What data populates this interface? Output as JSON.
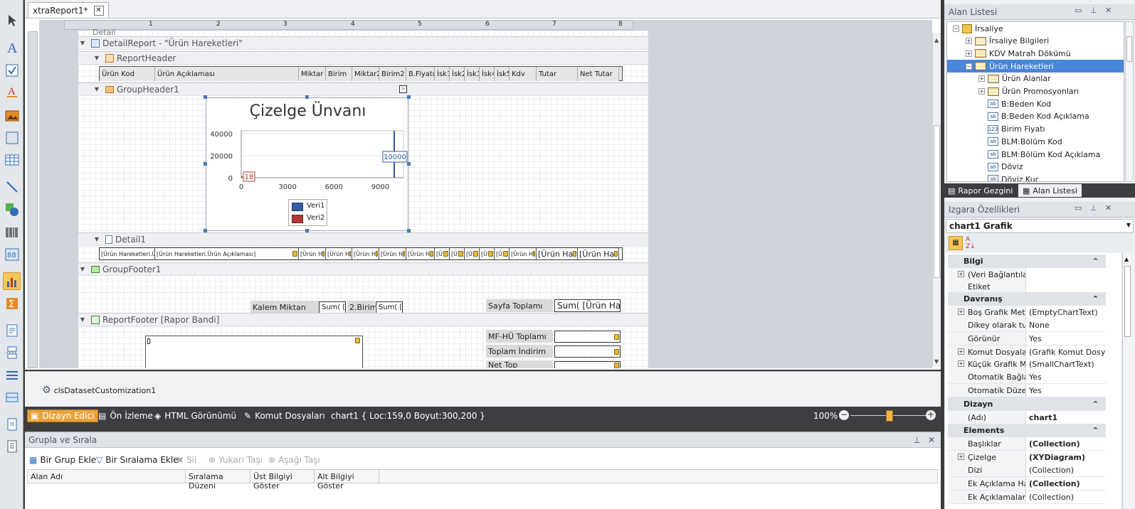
{
  "document_tab": {
    "title": "xtraReport1*"
  },
  "ruler": {
    "marks": [
      "1",
      "2",
      "3",
      "4",
      "5",
      "6",
      "7",
      "8"
    ]
  },
  "bands": {
    "detail_label": "Detail",
    "detail_report": "DetailReport - \"Ürün Hareketleri\"",
    "report_header": "ReportHeader",
    "group_header": "GroupHeader1",
    "detail1": "Detail1",
    "group_footer": "GroupFooter1",
    "report_footer": "ReportFooter [Rapor Bandi]"
  },
  "header_cells": [
    "Ürün Kod",
    "Ürün Açıklaması",
    "Miktar",
    "Birim",
    "Miktar2",
    "Birim2",
    "B.Fiyatı",
    "İsk1",
    "İsk2",
    "İsk3",
    "İsk4",
    "İsk5",
    "Kdv",
    "Tutar",
    "Net Tutar"
  ],
  "detail_cells": [
    "[Ürün Hareketleri.Ü",
    "[Ürün Hareketleri.Ürün Açıklaması]",
    "[Ürün H",
    "[Ürün H",
    "[Ürün H",
    "[Ürün H",
    "[Ürün H",
    "[Ü",
    "[Ü",
    "[Ü",
    "[Ü",
    "[Ü",
    "[Ürün H",
    "[Ürün Ha",
    "[Ürün Ha"
  ],
  "chart": {
    "title": "Çizelge Ünvanı",
    "y_ticks": [
      "40000",
      "20000",
      "0"
    ],
    "x_ticks": [
      "0",
      "3000",
      "6000",
      "9000"
    ],
    "label_a": "18",
    "label_b": "10000",
    "legend": [
      "Veri1",
      "Veri2"
    ],
    "colors": {
      "veri1": "#2f5e9e",
      "veri2": "#b03a3a"
    }
  },
  "chart_data": {
    "type": "bar",
    "title": "Çizelge Ünvanı",
    "x": [
      0,
      9900
    ],
    "series": [
      {
        "name": "Veri1",
        "values": [
          0,
          10000
        ]
      },
      {
        "name": "Veri2",
        "values": [
          18,
          0
        ]
      }
    ],
    "xlim": [
      0,
      10500
    ],
    "ylim": [
      0,
      40000
    ],
    "legend": "bottom"
  },
  "footer": {
    "kalem_miktar": "Kalem Miktan",
    "sum1": "Sum( [",
    "birim2": "2.Birim",
    "sum2": "Sum( [",
    "sayfa_toplami": "Sayfa Toplamı",
    "sum3": "Sum( [Ürün Ha",
    "mf_hu": "MF-HÜ Toplamı",
    "toplam_indirim": "Toplam İndirim",
    "net_partial": "Net Top"
  },
  "component": {
    "name": "clsDatasetCustomization1"
  },
  "status": {
    "designer": "Dizayn Edici",
    "preview": "Ön İzleme",
    "html_view": "HTML Görünümü",
    "scripts": "Komut Dosyaları",
    "selection": "chart1 { Loc:159,0 Boyut:300,200 }",
    "zoom": "100%",
    "zoom_level": 0.5
  },
  "group_panel": {
    "title": "Grupla ve Sırala",
    "add_group": "Bir Grup Ekle",
    "add_sort": "Bir Sıralama Ekle",
    "delete": "Sil",
    "move_up": "Yukarı Taşı",
    "move_down": "Aşağı Taşı",
    "columns": [
      "Alan Adı",
      "Sıralama Düzeni",
      "Üst Bilgiyi Göster",
      "Alt Bilgiyi Göster"
    ]
  },
  "field_list": {
    "title": "Alan Listesi",
    "items": [
      "İrsaliye",
      "İrsaliye Bilgileri",
      "KDV Matrah Dökümü",
      "Ürün Hareketleri",
      "Ürün Alanlar",
      "Ürün Promosyonları",
      "B:Beden Kod",
      "B:Beden Kod Açıklama",
      "Birim Fiyatı",
      "BLM:Bölüm Kod",
      "BLM:Bölüm Kod Açıklama",
      "Döviz",
      "Döviz Kur"
    ],
    "tab_explorer": "Rapor Gezgini",
    "tab_fields": "Alan Listesi"
  },
  "props": {
    "title": "Izgara Özellikleri",
    "selected": "chart1   Grafik",
    "categories": {
      "bilgi": "Bilgi",
      "davranis": "Davranış",
      "dizayn": "Dizayn",
      "elements": "Elements"
    },
    "rows": [
      {
        "name": "(Veri Bağlantıları)",
        "value": ""
      },
      {
        "name": "Etiket",
        "value": ""
      },
      {
        "name": "Boş Grafik Metni",
        "value": "(EmptyChartText)"
      },
      {
        "name": "Dikey olarak tut",
        "value": "None"
      },
      {
        "name": "Görünür",
        "value": "Yes"
      },
      {
        "name": "Komut Dosyaları",
        "value": "(Grafik Komut Dosy…"
      },
      {
        "name": "Küçük Grafik Metı",
        "value": "(SmallChartText)"
      },
      {
        "name": "Otomatik Bağlant",
        "value": "Yes"
      },
      {
        "name": "Otomatik Düzen /",
        "value": "Yes"
      },
      {
        "name": "(Adı)",
        "value": "chart1"
      },
      {
        "name": "Başlıklar",
        "value": "(Collection)"
      },
      {
        "name": "Çizelge",
        "value": "(XYDiagram)"
      },
      {
        "name": "Dizi",
        "value": "(Collection)"
      },
      {
        "name": "Ek Açıklama Havu",
        "value": "(Collection)"
      },
      {
        "name": "Ek Açıklamalar",
        "value": "(Collection)"
      }
    ]
  }
}
